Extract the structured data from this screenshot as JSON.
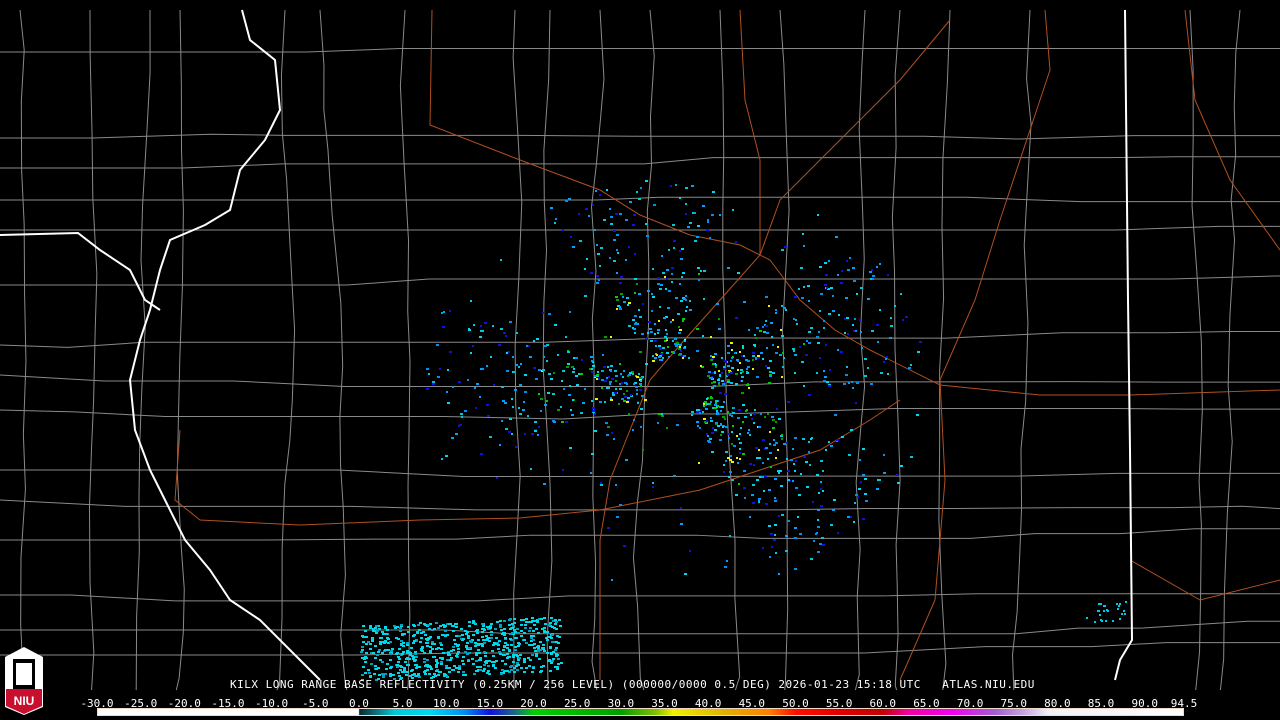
{
  "product_title": "KILX LONG RANGE BASE REFLECTIVITY (0.25KM / 256 LEVEL) (000000/0000 0.5 DEG) 2026-01-23 15:18 UTC   ATLAS.NIU.EDU",
  "logo_text": "NIU",
  "colorbar": {
    "min": -30.0,
    "max": 94.5,
    "tick_labels": [
      "-30.0",
      "-25.0",
      "-20.0",
      "-15.0",
      "-10.0",
      "-5.0",
      "0.0",
      "5.0",
      "10.0",
      "15.0",
      "20.0",
      "25.0",
      "30.0",
      "35.0",
      "40.0",
      "45.0",
      "50.0",
      "55.0",
      "60.0",
      "65.0",
      "70.0",
      "75.0",
      "80.0",
      "85.0",
      "90.0",
      "94.5"
    ],
    "tick_values": [
      -30,
      -25,
      -20,
      -15,
      -10,
      -5,
      0,
      5,
      10,
      15,
      20,
      25,
      30,
      35,
      40,
      45,
      50,
      55,
      60,
      65,
      70,
      75,
      80,
      85,
      90,
      94.5
    ],
    "color_stops": [
      {
        "v": -30,
        "c": "#ffffff"
      },
      {
        "v": -0.1,
        "c": "#ffffff"
      },
      {
        "v": 0,
        "c": "#0a2a30"
      },
      {
        "v": 2,
        "c": "#0d7480"
      },
      {
        "v": 4,
        "c": "#00c8d8"
      },
      {
        "v": 8,
        "c": "#00d8f0"
      },
      {
        "v": 12,
        "c": "#0090f0"
      },
      {
        "v": 15,
        "c": "#1010e0"
      },
      {
        "v": 18,
        "c": "#1a7080"
      },
      {
        "v": 20,
        "c": "#00d000"
      },
      {
        "v": 30,
        "c": "#00a000"
      },
      {
        "v": 34,
        "c": "#80c000"
      },
      {
        "v": 36,
        "c": "#f0f000"
      },
      {
        "v": 42,
        "c": "#e0b000"
      },
      {
        "v": 47,
        "c": "#ff8000"
      },
      {
        "v": 50,
        "c": "#ff1000"
      },
      {
        "v": 55,
        "c": "#e00000"
      },
      {
        "v": 60,
        "c": "#c00000"
      },
      {
        "v": 63,
        "c": "#f000a0"
      },
      {
        "v": 68,
        "c": "#f000f0"
      },
      {
        "v": 73,
        "c": "#a060d0"
      },
      {
        "v": 76,
        "c": "#c0a0e0"
      },
      {
        "v": 79,
        "c": "#f0f0f8"
      },
      {
        "v": 94.5,
        "c": "#ffffff"
      }
    ]
  },
  "colors": {
    "county": "#8a8a8a",
    "state": "#ffffff",
    "highway": "#b05020",
    "background": "#000000"
  }
}
